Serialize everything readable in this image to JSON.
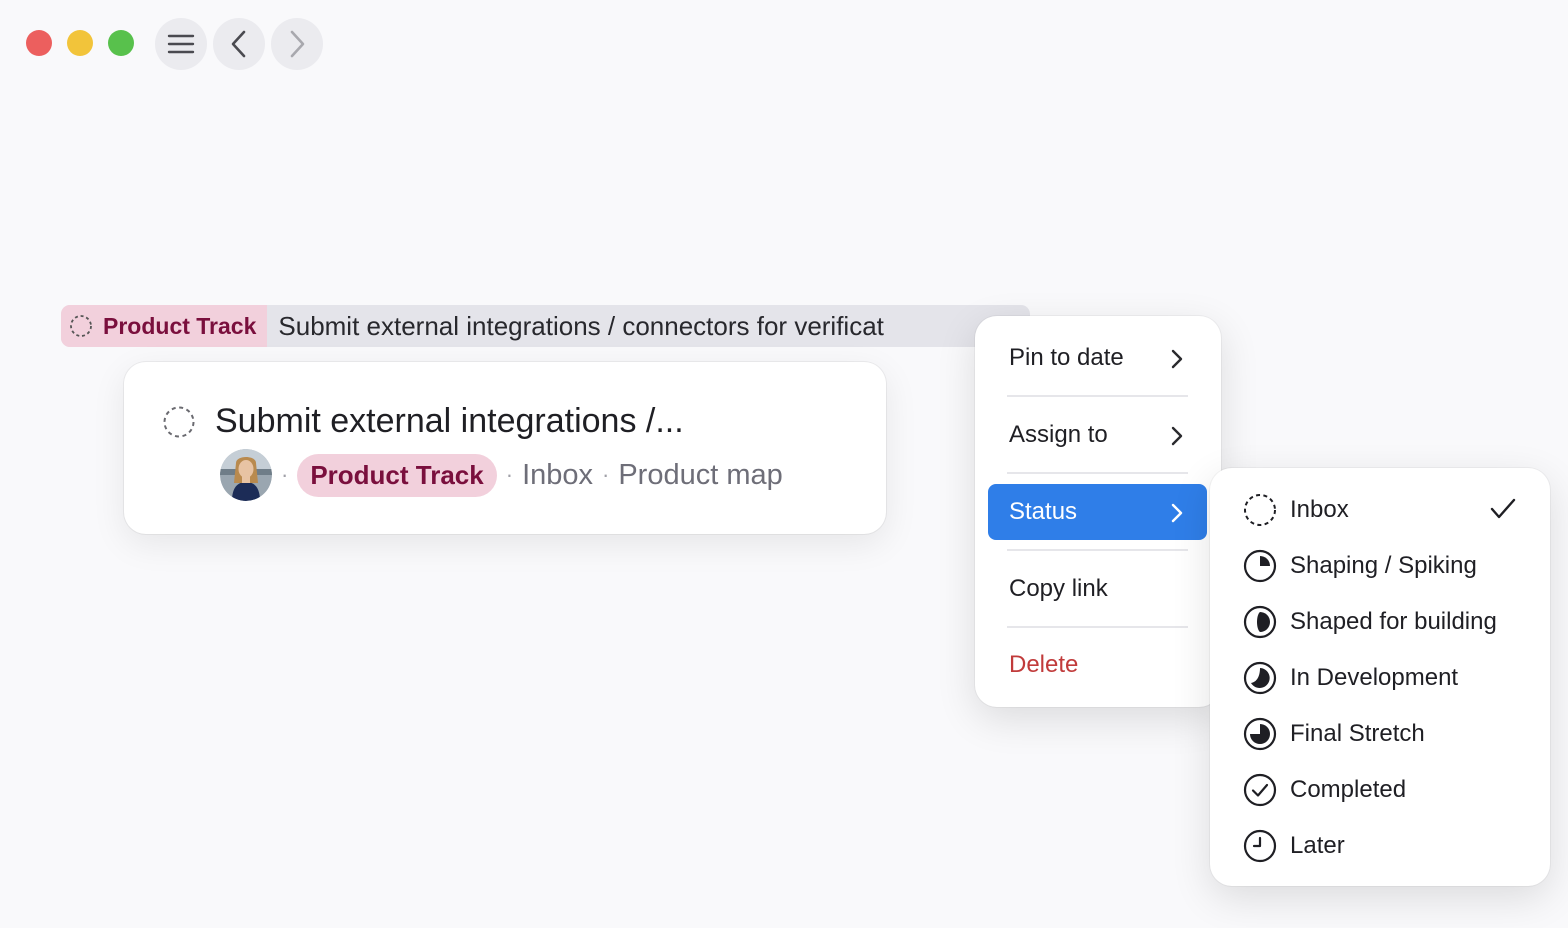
{
  "window": {
    "controls": [
      "close",
      "minimize",
      "zoom"
    ],
    "nav_icons": [
      "hamburger-icon",
      "chevron-left-icon",
      "chevron-right-icon"
    ]
  },
  "drag_row": {
    "tag": "Product Track",
    "title": "Submit external integrations / connectors for verificat"
  },
  "card": {
    "title": "Submit external integrations /...",
    "tag": "Product Track",
    "separator": "·",
    "status": "Inbox",
    "project": "Product map"
  },
  "context_menu": {
    "items": [
      {
        "label": "Pin to date",
        "has_submenu": true
      },
      {
        "label": "Assign to",
        "has_submenu": true
      },
      {
        "label": "Status",
        "has_submenu": true,
        "active": true
      },
      {
        "label": "Copy link",
        "has_submenu": false
      },
      {
        "label": "Delete",
        "has_submenu": false,
        "danger": true
      }
    ]
  },
  "status_menu": {
    "selected": "Inbox",
    "items": [
      {
        "label": "Inbox",
        "icon": "dashed-circle-icon"
      },
      {
        "label": "Shaping / Spiking",
        "icon": "quarter-circle-icon"
      },
      {
        "label": "Shaped for building",
        "icon": "half-circle-icon"
      },
      {
        "label": "In Development",
        "icon": "crescent-circle-icon"
      },
      {
        "label": "Final Stretch",
        "icon": "three-quarter-circle-icon"
      },
      {
        "label": "Completed",
        "icon": "check-circle-icon"
      },
      {
        "label": "Later",
        "icon": "clock-icon"
      }
    ]
  },
  "colors": {
    "background": "#f9f9fb",
    "tag_bg": "#f2d0dc",
    "tag_text": "#7a0f3d",
    "active_blue": "#2f7ee8",
    "danger": "#c13b3b"
  }
}
